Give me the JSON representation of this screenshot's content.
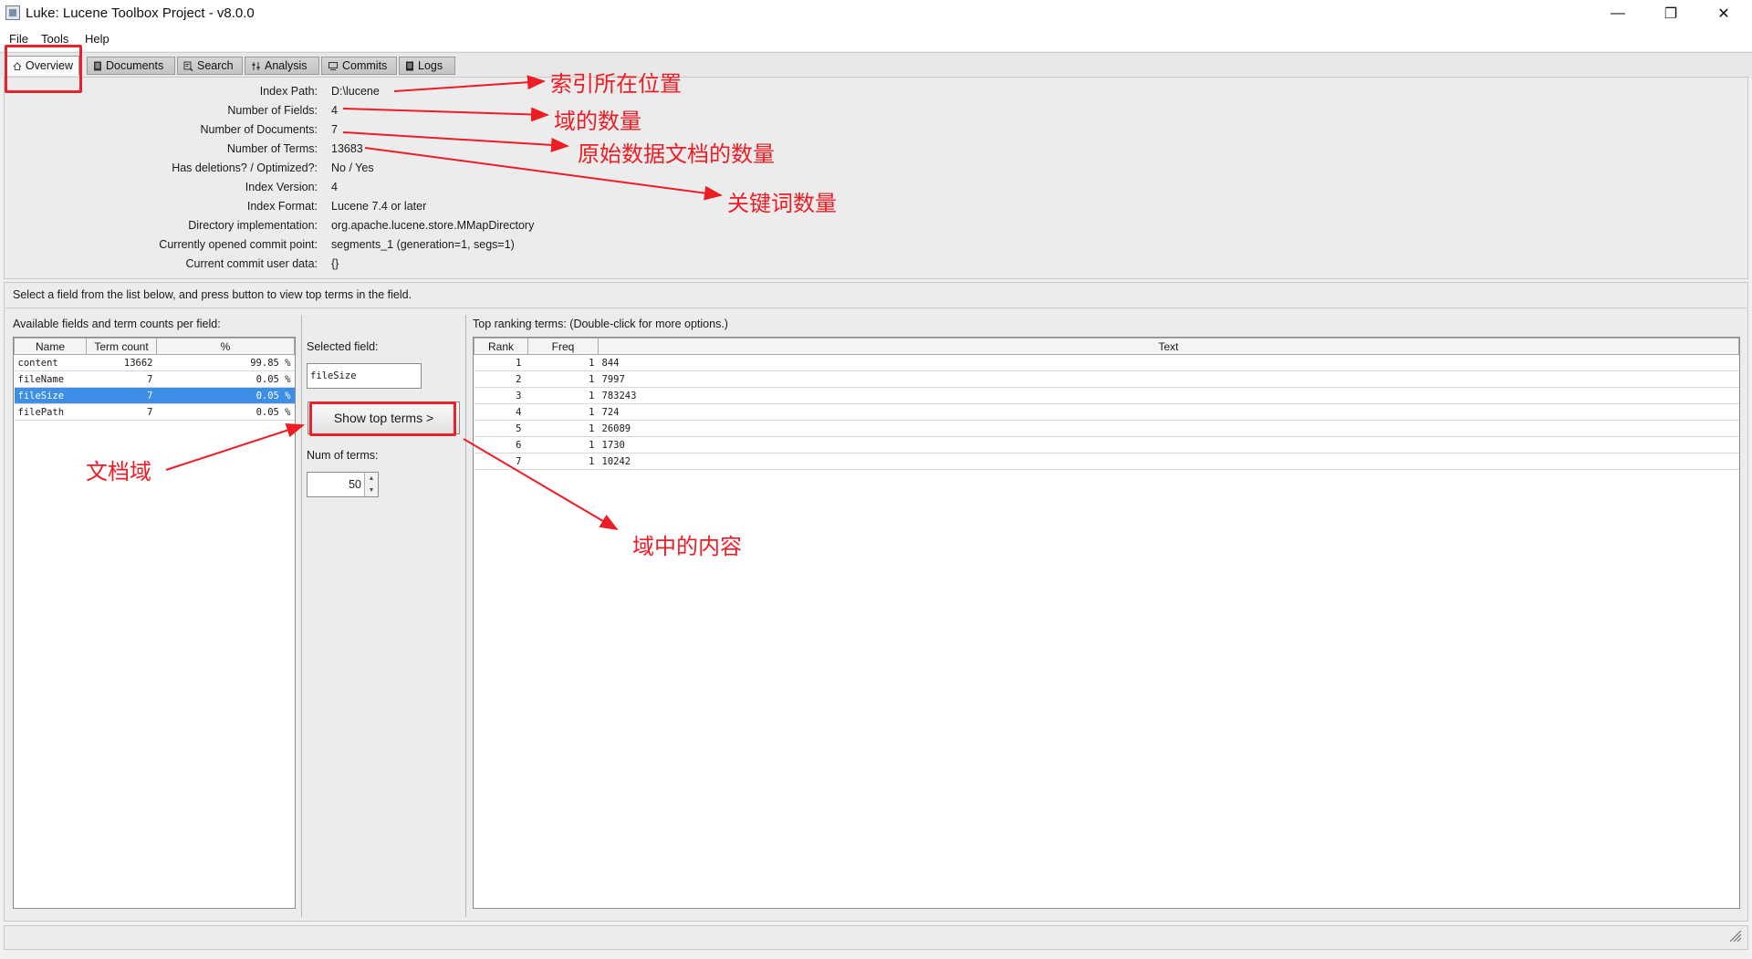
{
  "window": {
    "title": "Luke: Lucene Toolbox Project - v8.0.0",
    "controls": [
      "—",
      "❐",
      "✕"
    ]
  },
  "menu": [
    "File",
    "Tools",
    "Help"
  ],
  "tabs": [
    {
      "label": "Overview",
      "icon": "home-icon"
    },
    {
      "label": "Documents",
      "icon": "document-icon"
    },
    {
      "label": "Search",
      "icon": "search-icon"
    },
    {
      "label": "Analysis",
      "icon": "analysis-icon"
    },
    {
      "label": "Commits",
      "icon": "commits-icon"
    },
    {
      "label": "Logs",
      "icon": "logs-icon"
    }
  ],
  "overview": [
    {
      "label": "Index Path:",
      "value": "D:\\lucene"
    },
    {
      "label": "Number of Fields:",
      "value": "4"
    },
    {
      "label": "Number of Documents:",
      "value": "7"
    },
    {
      "label": "Number of Terms:",
      "value": "13683"
    },
    {
      "label": "Has deletions? / Optimized?:",
      "value": "No / Yes"
    },
    {
      "label": "Index Version:",
      "value": "4"
    },
    {
      "label": "Index Format:",
      "value": "Lucene 7.4 or later"
    },
    {
      "label": "Directory implementation:",
      "value": "org.apache.lucene.store.MMapDirectory"
    },
    {
      "label": "Currently opened commit point:",
      "value": "segments_1 (generation=1, segs=1)"
    },
    {
      "label": "Current commit user data:",
      "value": "{}"
    }
  ],
  "hint": "Select a field from the list below, and press button to view top terms in the field.",
  "fields_panel": {
    "title": "Available fields and term counts per field:",
    "headers": [
      "Name",
      "Term count",
      "%"
    ],
    "rows": [
      {
        "name": "content",
        "count": "13662",
        "pct": "99.85 %"
      },
      {
        "name": "fileName",
        "count": "7",
        "pct": "0.05 %"
      },
      {
        "name": "fileSize",
        "count": "7",
        "pct": "0.05 %"
      },
      {
        "name": "filePath",
        "count": "7",
        "pct": "0.05 %"
      }
    ]
  },
  "middle": {
    "selected_label": "Selected field:",
    "selected_value": "fileSize",
    "button": "Show top terms >",
    "num_label": "Num of terms:",
    "num_value": "50"
  },
  "terms_panel": {
    "title": "Top ranking terms: (Double-click for more options.)",
    "headers": [
      "Rank",
      "Freq",
      "Text"
    ],
    "rows": [
      {
        "rank": "1",
        "freq": "1",
        "text": "844"
      },
      {
        "rank": "2",
        "freq": "1",
        "text": "7997"
      },
      {
        "rank": "3",
        "freq": "1",
        "text": "783243"
      },
      {
        "rank": "4",
        "freq": "1",
        "text": "724"
      },
      {
        "rank": "5",
        "freq": "1",
        "text": "26089"
      },
      {
        "rank": "6",
        "freq": "1",
        "text": "1730"
      },
      {
        "rank": "7",
        "freq": "1",
        "text": "10242"
      }
    ]
  },
  "annotations": {
    "index_location": "索引所在位置",
    "field_count": "域的数量",
    "doc_count": "原始数据文档的数量",
    "term_count": "关键词数量",
    "doc_fields": "文档域",
    "field_content": "域中的内容",
    "color": "#ee1c24"
  }
}
